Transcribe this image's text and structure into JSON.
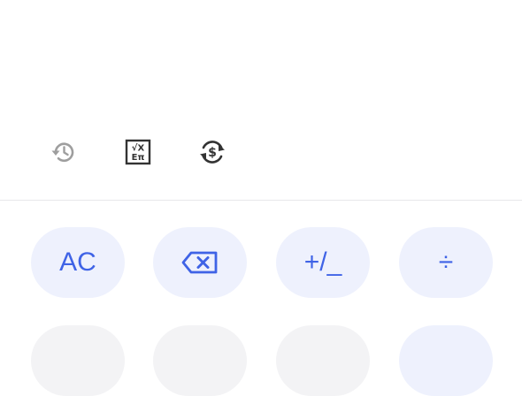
{
  "colors": {
    "accent": "#3f63e6",
    "key_bg": "#eef1fd",
    "key_bg_secondary": "#f3f3f5",
    "icon_gray": "#9e9e9e",
    "icon_dark": "#333333"
  },
  "display": {
    "expression": "",
    "result": ""
  },
  "toolbar": {
    "items": [
      {
        "icon": "history-icon"
      },
      {
        "icon": "scientific-functions-icon",
        "glyph_top": "√X",
        "glyph_bottom": "Eπ"
      },
      {
        "icon": "currency-converter-icon",
        "glyph": "$"
      }
    ]
  },
  "keypad": {
    "row1": [
      {
        "label": "AC"
      },
      {
        "icon": "backspace-icon"
      },
      {
        "label": "+/_"
      },
      {
        "label": "÷"
      }
    ]
  }
}
